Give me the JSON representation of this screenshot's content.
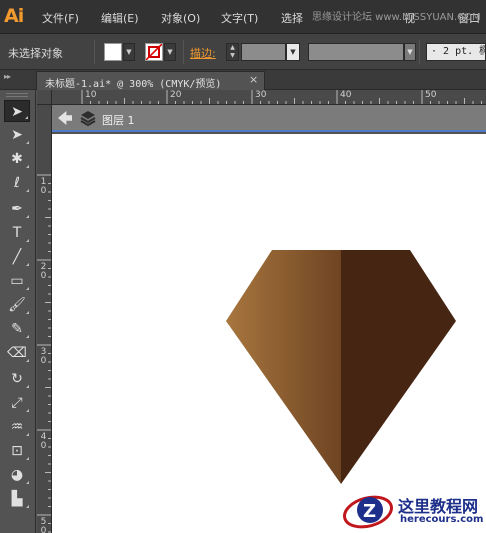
{
  "app": {
    "logo": "Ai"
  },
  "menu": [
    {
      "label": "文件(F)"
    },
    {
      "label": "编辑(E)"
    },
    {
      "label": "对象(O)"
    },
    {
      "label": "文字(T)"
    },
    {
      "label": "选择"
    },
    {
      "label": "视"
    },
    {
      "label": "窗口"
    }
  ],
  "watermark_top": "思缘设计论坛 www.MISSYUAN.COM",
  "control_bar": {
    "selection_status": "未选择对象",
    "fill_color": "#ffffff",
    "stroke_color": "none",
    "stroke_label": "描边:",
    "stroke_weight": "",
    "brush_value": "· 2 pt. 椭"
  },
  "document_tab": {
    "title": "未标题-1.ai* @ 300% (CMYK/预览)",
    "close": "×"
  },
  "rulers": {
    "horizontal": [
      "10",
      "20",
      "30",
      "40",
      "50"
    ],
    "vertical": [
      "1",
      "2",
      "3",
      "4",
      "5"
    ],
    "vertical_suffix": "0"
  },
  "layer_bar": {
    "label": "图层 1"
  },
  "tools": [
    {
      "name": "selection-tool",
      "glyph": "➤",
      "active": true
    },
    {
      "name": "direct-selection-tool",
      "glyph": "➤"
    },
    {
      "name": "magic-wand-tool",
      "glyph": "✱"
    },
    {
      "name": "lasso-tool",
      "glyph": "ℓ"
    },
    {
      "name": "pen-tool",
      "glyph": "✒"
    },
    {
      "name": "type-tool",
      "glyph": "T"
    },
    {
      "name": "line-segment-tool",
      "glyph": "╱"
    },
    {
      "name": "rectangle-tool",
      "glyph": "▭"
    },
    {
      "name": "paintbrush-tool",
      "glyph": "🖌"
    },
    {
      "name": "blob-brush-tool",
      "glyph": "✎"
    },
    {
      "name": "eraser-tool",
      "glyph": "⌫"
    },
    {
      "name": "rotate-tool",
      "glyph": "↻"
    },
    {
      "name": "scale-tool",
      "glyph": "⤢"
    },
    {
      "name": "warp-tool",
      "glyph": "♒"
    },
    {
      "name": "free-transform-tool",
      "glyph": "⊡"
    },
    {
      "name": "shape-builder-tool",
      "glyph": "◕"
    },
    {
      "name": "graph-tool",
      "glyph": "▙"
    }
  ],
  "artwork": {
    "left_gradient": [
      "#a8763e",
      "#6e4422"
    ],
    "right_color": "#462512"
  },
  "watermark_logo": {
    "name": "这里教程网",
    "url": "herecours.com"
  }
}
